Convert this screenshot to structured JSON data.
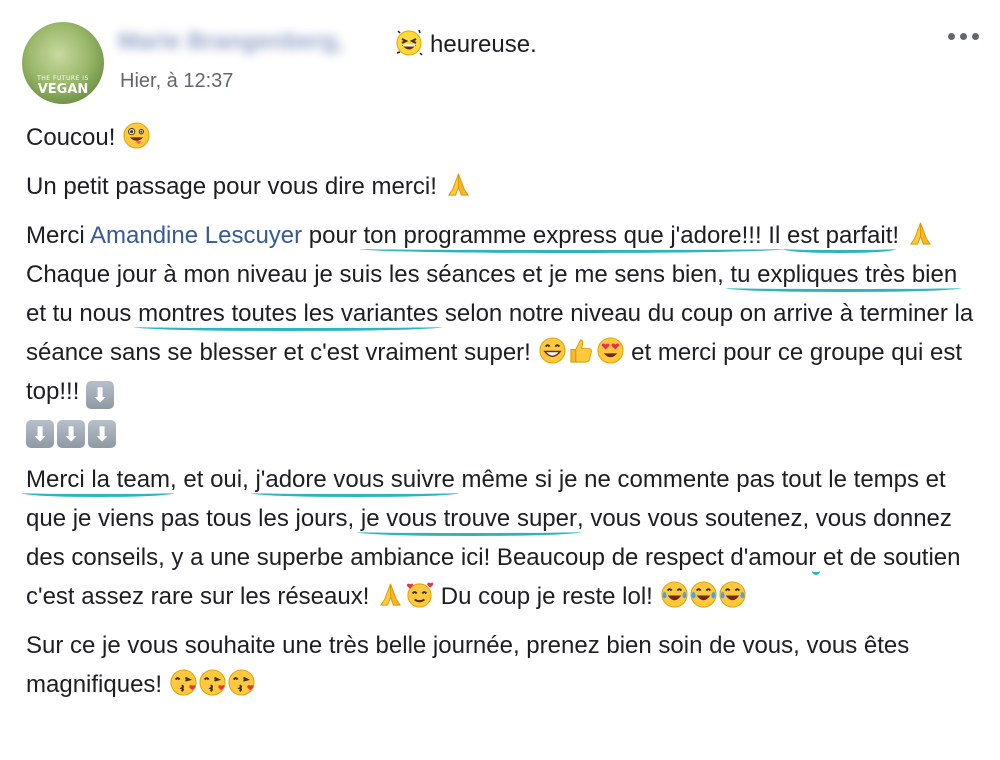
{
  "post": {
    "author": {
      "name": "Marie Brangenberg,",
      "avatar_text_line1": "THE FUTURE IS",
      "avatar_text_line2": "VEGAN"
    },
    "feeling": {
      "icon": "grinning-squinting-face-icon",
      "text": "heureuse."
    },
    "timestamp": "Hier, à 12:37",
    "menu_icon": "more-options-icon",
    "highlight_color": "#2bb5bf",
    "link_color": "#385898",
    "paragraphs": {
      "p1": {
        "text": "Coucou!",
        "emoji": "zany-face-icon"
      },
      "p2": {
        "text": "Un petit passage pour vous dire merci!",
        "emoji": "folded-hands-icon"
      },
      "p3": {
        "t1": "Merci ",
        "mention": "Amandine Lescuyer",
        "t2": " pour ",
        "h1": "ton programme express que j'adore!!! Il",
        "t3": " ",
        "h2": "est parfait",
        "t4": "! ",
        "t5": " Chaque jour à mon niveau je suis les séances et je me sens bien, ",
        "h3": "tu expliques très bien",
        "t6": " et tu nous ",
        "h4": "montres toutes les variantes",
        "t7": " selon notre niveau du coup on arrive à terminer la séance sans se blesser et c'est vraiment super! ",
        "t8": " et merci pour ce groupe qui est top!!! ",
        "arrow": "⬇"
      },
      "p4": {
        "h1": "Merci la team",
        "t1": ", et oui, ",
        "h2": "j'adore vous suivre",
        "t2": " même si je ne commente pas tout le temps et que je viens pas tous les jours, ",
        "h3": "je vous trouve super",
        "t3": ", vous vous soutenez, ",
        "h4": "vous donnez des conseils, y a une superbe ambiance ici!",
        "t4": " Beaucoup de respect d'amour et de soutien c'est assez rare sur les réseaux! ",
        "t5": " Du coup je reste lol! "
      },
      "p5": {
        "text": "Sur ce je vous souhaite une très belle journée, prenez bien soin de vous, vous êtes magnifiques! "
      }
    }
  }
}
